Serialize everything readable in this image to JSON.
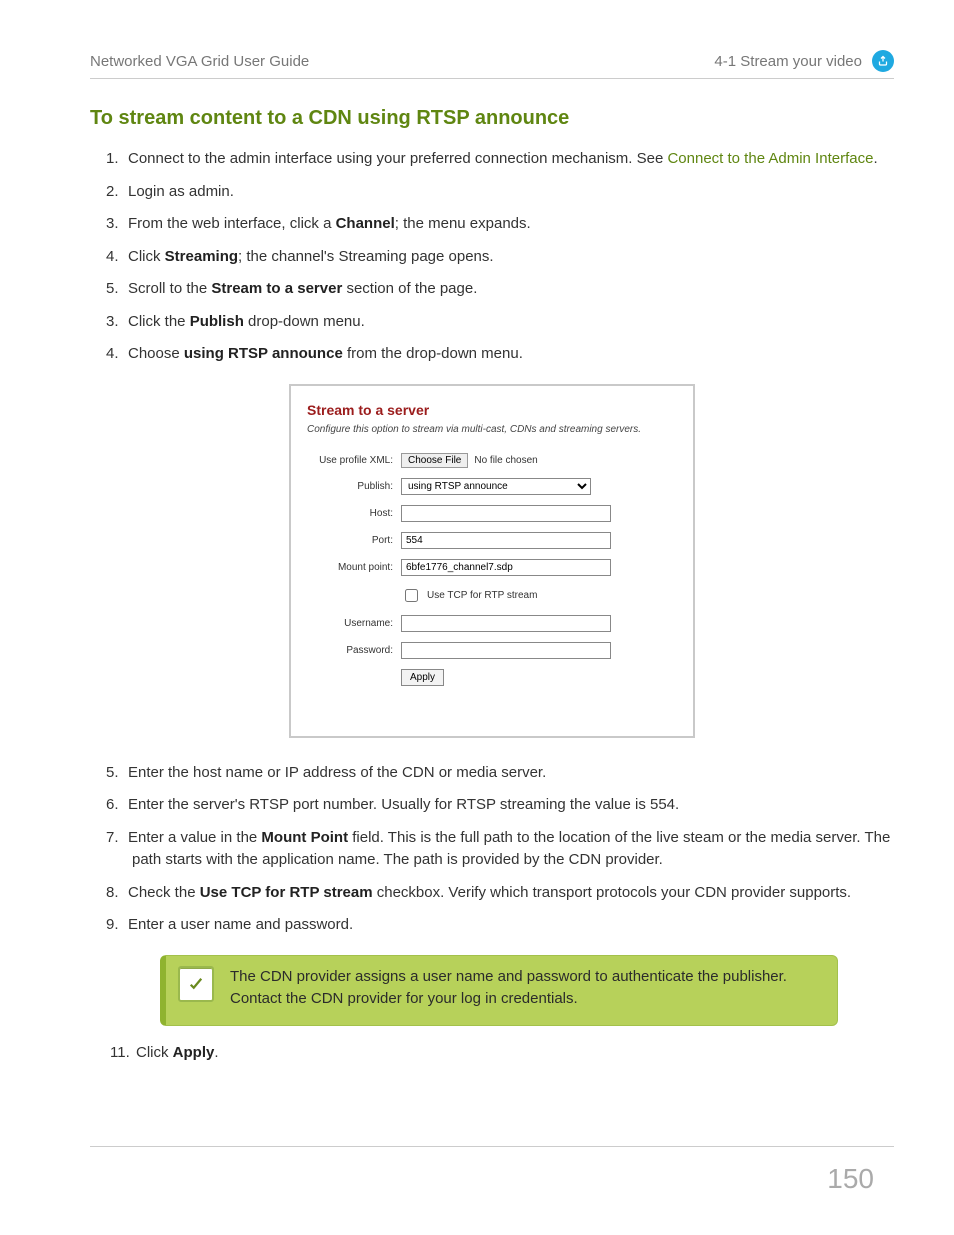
{
  "header": {
    "left": "Networked VGA Grid User Guide",
    "right": "4-1 Stream your video"
  },
  "title": "To stream content to a CDN using RTSP announce",
  "steps_block_a": [
    {
      "n": "1.",
      "html": "Connect to the admin interface using your preferred connection mechanism. See <span class='link-green' data-name='link-connect-admin' data-interactable='true'>Connect to the Admin Interface</span>."
    },
    {
      "n": "2.",
      "html": "Login as admin."
    },
    {
      "n": "3.",
      "html": "From the web interface, click a <span class='bold'>Channel</span>; the menu expands."
    },
    {
      "n": "4.",
      "html": "Click <span class='bold'>Streaming</span>; the channel's Streaming page opens."
    },
    {
      "n": "5.",
      "html": "Scroll to the <span class='bold'>Stream to a server</span> section of the page."
    },
    {
      "n": "3.",
      "html": "Click the <span class='bold'>Publish</span> drop-down menu."
    },
    {
      "n": "4.",
      "html": "Choose <span class='bold'>using RTSP announce</span> from the drop-down menu."
    }
  ],
  "shot": {
    "title": "Stream to a server",
    "subtitle": "Configure this option to stream via multi-cast, CDNs and streaming servers.",
    "labels": {
      "profile": "Use profile XML:",
      "choose_file": "Choose File",
      "no_file": "No file chosen",
      "publish": "Publish:",
      "publish_value": "using RTSP announce",
      "host": "Host:",
      "port": "Port:",
      "port_value": "554",
      "mount": "Mount point:",
      "mount_value": "6bfe1776_channel7.sdp",
      "tcp": "Use TCP for RTP stream",
      "username": "Username:",
      "password": "Password:",
      "apply": "Apply"
    }
  },
  "steps_block_b": [
    {
      "n": "5.",
      "html": "Enter the host name or IP address of the CDN or media server."
    },
    {
      "n": "6.",
      "html": "Enter the server's RTSP port number. Usually for RTSP streaming the value is 554."
    },
    {
      "n": "7.",
      "html": "Enter a value in the <span class='bold'>Mount Point</span> field. This is the full path to the location of the live steam or the media server. The path starts with the application name. The path is provided by the CDN provider."
    },
    {
      "n": "8.",
      "html": "Check the <span class='bold'>Use TCP for RTP stream</span> checkbox. Verify which transport protocols your CDN provider supports."
    },
    {
      "n": "9.",
      "html": "Enter a user name and password."
    }
  ],
  "callout": "The CDN provider assigns a user name and password to authenticate the publisher. Contact the CDN provider for your log in credentials.",
  "final_step": {
    "n": "11.",
    "html": "Click <span class='bold'>Apply</span>."
  },
  "page_number": "150"
}
